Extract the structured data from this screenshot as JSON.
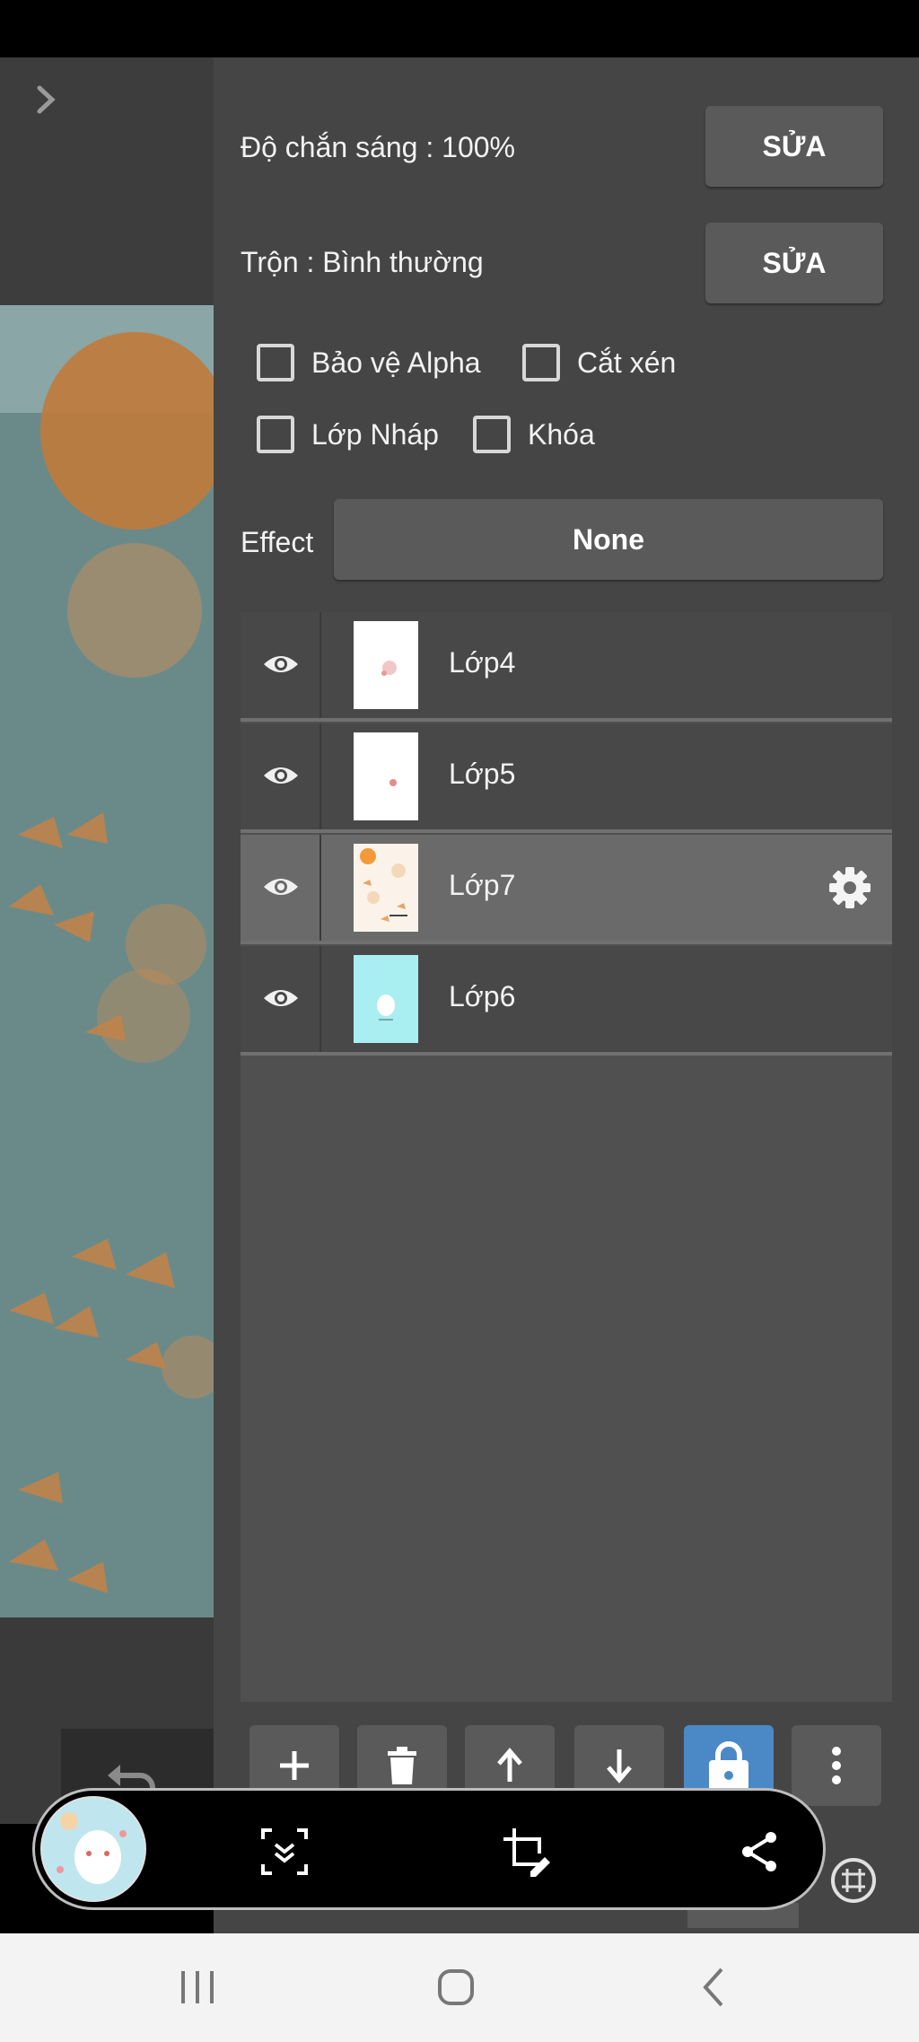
{
  "panel": {
    "opacity_label": "Độ chắn sáng : 100%",
    "opacity_edit": "SỬA",
    "blend_label": "Trộn : Bình thường",
    "blend_edit": "SỬA",
    "checkboxes": {
      "alpha_protect": "Bảo vệ Alpha",
      "clipping": "Cắt xén",
      "draft_layer": "Lớp Nháp",
      "lock": "Khóa"
    },
    "effect_label": "Effect",
    "effect_value": "None"
  },
  "layers": [
    {
      "name": "Lớp4",
      "visible": true,
      "selected": false
    },
    {
      "name": "Lớp5",
      "visible": true,
      "selected": false
    },
    {
      "name": "Lớp7",
      "visible": true,
      "selected": true
    },
    {
      "name": "Lớp6",
      "visible": true,
      "selected": false
    }
  ],
  "toolbar_icons": [
    "add-icon",
    "trash-icon",
    "arrow-up-icon",
    "arrow-down-icon",
    "lock-icon",
    "more-vertical-icon"
  ],
  "floating_bar_icons": [
    "scroll-capture-icon",
    "crop-edit-icon",
    "share-icon"
  ],
  "nav_icons": [
    "recents-icon",
    "home-icon",
    "back-icon"
  ],
  "colors": {
    "panel_bg": "#454545",
    "selected_row": "#6a6a6a",
    "lock_active": "#4a89c6",
    "canvas_teal": "#6a8a8a",
    "canvas_orange": "#c07a3a"
  }
}
